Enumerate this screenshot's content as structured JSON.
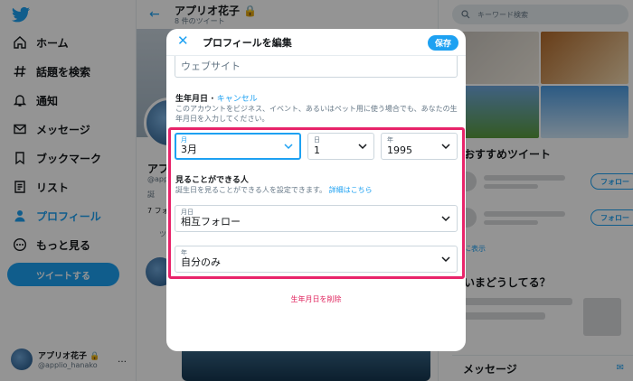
{
  "sidebar": {
    "items": [
      {
        "label": "ホーム",
        "icon": "home-icon"
      },
      {
        "label": "話題を検索",
        "icon": "hashtag-icon"
      },
      {
        "label": "通知",
        "icon": "bell-icon"
      },
      {
        "label": "メッセージ",
        "icon": "mail-icon"
      },
      {
        "label": "ブックマーク",
        "icon": "bookmark-icon"
      },
      {
        "label": "リスト",
        "icon": "list-icon"
      },
      {
        "label": "プロフィール",
        "icon": "person-icon",
        "active": true
      },
      {
        "label": "もっと見る",
        "icon": "more-circle-icon"
      }
    ],
    "tweet_button": "ツイートする",
    "account": {
      "name": "アプリオ花子",
      "handle": "@applio_hanako",
      "more": "…"
    }
  },
  "main": {
    "title": "アプリオ花子",
    "subtitle": "8 件のツイート",
    "profile_name": "アプリ",
    "profile_handle": "@appli",
    "profile_born": "誕",
    "profile_follow": "7 フォ",
    "tab_partial": "ツ"
  },
  "right": {
    "search_placeholder": "キーワード検索",
    "recommend_title": "おすすめツイート",
    "follow_label": "フォロー",
    "more_label": "に表示",
    "now_title": "いまどうしてる？",
    "messages_title": "メッセージ"
  },
  "modal": {
    "title": "プロフィールを編集",
    "save": "保存",
    "website_placeholder": "ウェブサイト",
    "birthday_label": "生年月日",
    "separator": " · ",
    "cancel": "キャンセル",
    "birthday_desc": "このアカウントをビジネス、イベント、あるいはペット用に使う場合でも、あなたの生年月日を入力してください。",
    "month": {
      "label": "月",
      "value": "3月"
    },
    "day": {
      "label": "日",
      "value": "1"
    },
    "year": {
      "label": "年",
      "value": "1995"
    },
    "visibility_title": "見ることができる人",
    "visibility_desc": "誕生日を見ることができる人を設定できます。",
    "visibility_link": "詳細はこちら",
    "monthday_visibility": {
      "label": "月日",
      "value": "相互フォロー"
    },
    "year_visibility": {
      "label": "年",
      "value": "自分のみ"
    },
    "delete": "生年月日を削除"
  },
  "colors": {
    "accent": "#1da1f2",
    "highlight": "#e8246a",
    "danger": "#e0245e"
  }
}
